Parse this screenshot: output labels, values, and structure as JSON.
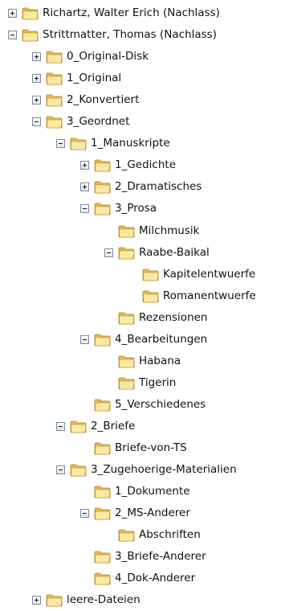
{
  "tree": {
    "items": [
      {
        "label": "Richartz, Walter Erich (Nachlass)",
        "level": 0,
        "toggle": "plus"
      },
      {
        "label": "Strittmatter, Thomas (Nachlass)",
        "level": 0,
        "toggle": "minus"
      },
      {
        "label": "0_Original-Disk",
        "level": 1,
        "toggle": "plus"
      },
      {
        "label": "1_Original",
        "level": 1,
        "toggle": "plus"
      },
      {
        "label": "2_Konvertiert",
        "level": 1,
        "toggle": "plus"
      },
      {
        "label": "3_Geordnet",
        "level": 1,
        "toggle": "minus"
      },
      {
        "label": "1_Manuskripte",
        "level": 2,
        "toggle": "minus"
      },
      {
        "label": "1_Gedichte",
        "level": 3,
        "toggle": "plus"
      },
      {
        "label": "2_Dramatisches",
        "level": 3,
        "toggle": "plus"
      },
      {
        "label": "3_Prosa",
        "level": 3,
        "toggle": "minus"
      },
      {
        "label": "Milchmusik",
        "level": 4,
        "toggle": "none"
      },
      {
        "label": "Raabe-Baikal",
        "level": 4,
        "toggle": "minus"
      },
      {
        "label": "Kapitelentwuerfe",
        "level": 5,
        "toggle": "none"
      },
      {
        "label": "Romanentwuerfe",
        "level": 5,
        "toggle": "none"
      },
      {
        "label": "Rezensionen",
        "level": 4,
        "toggle": "none"
      },
      {
        "label": "4_Bearbeitungen",
        "level": 3,
        "toggle": "minus"
      },
      {
        "label": "Habana",
        "level": 4,
        "toggle": "none"
      },
      {
        "label": "Tigerin",
        "level": 4,
        "toggle": "none"
      },
      {
        "label": "5_Verschiedenes",
        "level": 3,
        "toggle": "none"
      },
      {
        "label": "2_Briefe",
        "level": 2,
        "toggle": "minus"
      },
      {
        "label": "Briefe-von-TS",
        "level": 3,
        "toggle": "none"
      },
      {
        "label": "3_Zugehoerige-Materialien",
        "level": 2,
        "toggle": "minus"
      },
      {
        "label": "1_Dokumente",
        "level": 3,
        "toggle": "none"
      },
      {
        "label": "2_MS-Anderer",
        "level": 3,
        "toggle": "minus"
      },
      {
        "label": "Abschriften",
        "level": 4,
        "toggle": "none"
      },
      {
        "label": "3_Briefe-Anderer",
        "level": 3,
        "toggle": "none"
      },
      {
        "label": "4_Dok-Anderer",
        "level": 3,
        "toggle": "none"
      },
      {
        "label": "leere-Dateien",
        "level": 1,
        "toggle": "plus"
      }
    ]
  },
  "colors": {
    "folder_light": "#fce7a3",
    "folder_dark": "#e8b84a",
    "folder_outline": "#b0852a",
    "toggle_border": "#7a8aa0"
  }
}
